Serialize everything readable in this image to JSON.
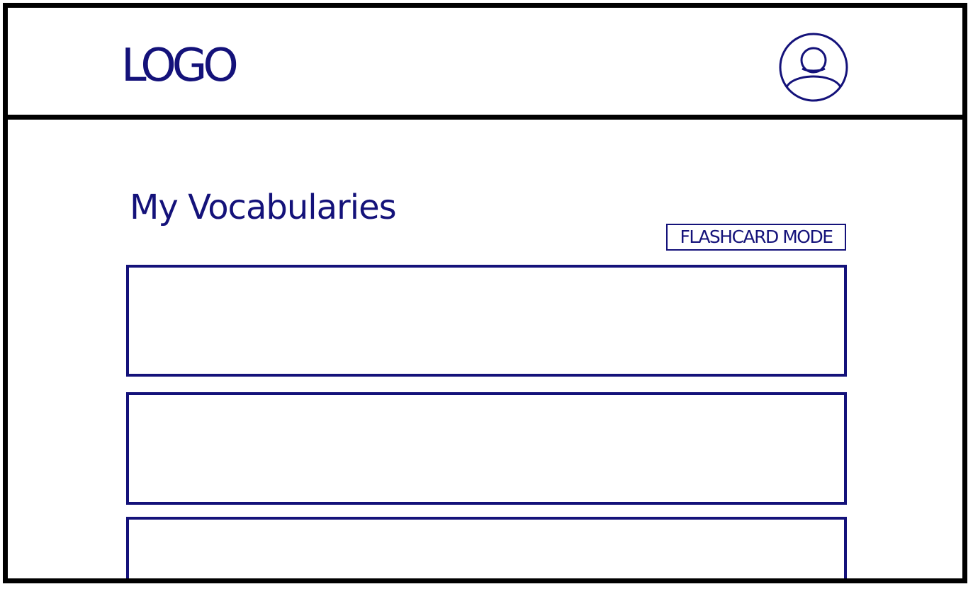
{
  "header": {
    "logo_text": "LOGO",
    "profile_icon": "user-circle-icon"
  },
  "main": {
    "title": "My Vocabularies",
    "flashcard_button_label": "FLASHCARD MODE",
    "vocab_cards": [
      "",
      "",
      ""
    ]
  },
  "colors": {
    "ink": "#14127a",
    "frame": "#000000",
    "background": "#ffffff"
  }
}
